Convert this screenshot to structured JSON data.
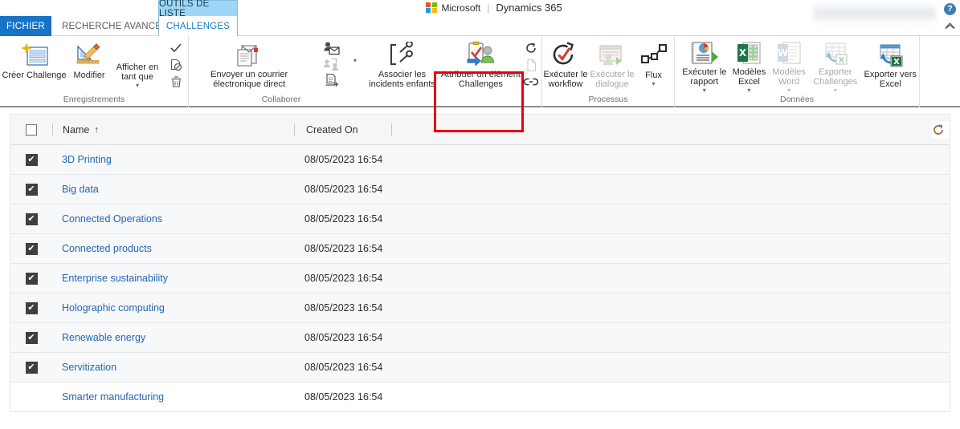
{
  "topbar": {
    "context_tab_group": "OUTILS DE LISTE",
    "tabs": [
      {
        "label": "FICHIER",
        "active": true
      },
      {
        "label": "RECHERCHE AVANCÉE",
        "active": false
      },
      {
        "label": "CHALLENGES",
        "active": false
      }
    ],
    "brand": {
      "microsoft": "Microsoft",
      "separator": "|",
      "product": "Dynamics 365"
    },
    "help_icon_glyph": "?",
    "home_icon_name": "home-icon",
    "user_name_blurred": ""
  },
  "ribbon": {
    "groups": [
      {
        "label": "Enregistrements",
        "buttons": [
          {
            "name": "creer-challenge",
            "label": "Créer Challenge",
            "icon": "new-record-icon",
            "disabled": false,
            "caret": false
          },
          {
            "name": "modifier",
            "label": "Modifier",
            "icon": "edit-pencil-icon",
            "disabled": false,
            "caret": false
          },
          {
            "name": "afficher-en-tant-que",
            "label": "Afficher en tant que",
            "icon": "",
            "disabled": false,
            "caret": true
          }
        ],
        "small_buttons": [
          {
            "name": "activer",
            "icon": "checkmark-icon"
          },
          {
            "name": "desactiver",
            "icon": "deactivate-doc-icon"
          },
          {
            "name": "supprimer",
            "icon": "trash-icon"
          }
        ]
      },
      {
        "label": "Collaborer",
        "buttons": [
          {
            "name": "envoyer-courrier-electronique-direct",
            "label": "Envoyer un courrier électronique direct",
            "icon": "email-document-icon",
            "disabled": false,
            "caret": false
          },
          {
            "name": "associer-les-incidents-enfants",
            "label": "Associer les incidents enfants",
            "icon": "wrench-bracket-icon",
            "disabled": false,
            "caret": false
          }
        ],
        "small_buttons": [
          {
            "name": "ajouter-liste-marketing",
            "icon": "person-mail-icon"
          },
          {
            "name": "connexions",
            "icon": "people-connect-icon"
          },
          {
            "name": "ajouter-note",
            "icon": "add-doc-icon"
          }
        ]
      },
      {
        "label": "",
        "buttons": [
          {
            "name": "attribuer-un-element-challenges",
            "label": "Attribuer un élément Challenges",
            "icon": "assign-record-icon",
            "disabled": false,
            "caret": false,
            "highlighted": true
          }
        ],
        "small_buttons": [
          {
            "name": "actualiser",
            "icon": "refresh-icon"
          },
          {
            "name": "document",
            "icon": "document-icon"
          },
          {
            "name": "lien",
            "icon": "link-icon"
          }
        ]
      },
      {
        "label": "Processus",
        "buttons": [
          {
            "name": "executer-le-workflow",
            "label": "Exécuter le workflow",
            "icon": "workflow-check-icon",
            "disabled": false,
            "caret": false
          },
          {
            "name": "executer-le-dialogue",
            "label": "Exécuter le dialogue",
            "icon": "dialog-run-icon",
            "disabled": true,
            "caret": false
          },
          {
            "name": "flux",
            "label": "Flux",
            "icon": "flow-nodes-icon",
            "disabled": false,
            "caret": true
          }
        ],
        "small_buttons": []
      },
      {
        "label": "Données",
        "buttons": [
          {
            "name": "executer-le-rapport",
            "label": "Exécuter le rapport",
            "icon": "report-chart-icon",
            "disabled": false,
            "caret": true
          },
          {
            "name": "modeles-excel",
            "label": "Modèles Excel",
            "icon": "excel-icon",
            "disabled": false,
            "caret": true
          },
          {
            "name": "modeles-word",
            "label": "Modèles Word",
            "icon": "word-icon",
            "disabled": true,
            "caret": true
          },
          {
            "name": "exporter-challenges",
            "label": "Exporter Challenges",
            "icon": "export-grid-icon",
            "disabled": true,
            "caret": true
          },
          {
            "name": "exporter-vers-excel",
            "label": "Exporter vers Excel",
            "icon": "export-excel-icon",
            "disabled": false,
            "caret": false
          }
        ],
        "small_buttons": []
      }
    ],
    "highlight_color": "#e8000d"
  },
  "grid": {
    "select_all_checked": false,
    "columns": [
      {
        "key": "name",
        "label": "Name",
        "sort": "↑"
      },
      {
        "key": "created_on",
        "label": "Created On",
        "sort": ""
      }
    ],
    "rows": [
      {
        "selected": true,
        "name": "3D Printing",
        "created_on": "08/05/2023 16:54"
      },
      {
        "selected": true,
        "name": "Big data",
        "created_on": "08/05/2023 16:54"
      },
      {
        "selected": true,
        "name": "Connected Operations",
        "created_on": "08/05/2023 16:54"
      },
      {
        "selected": true,
        "name": "Connected products",
        "created_on": "08/05/2023 16:54"
      },
      {
        "selected": true,
        "name": "Enterprise sustainability",
        "created_on": "08/05/2023 16:54"
      },
      {
        "selected": true,
        "name": "Holographic computing",
        "created_on": "08/05/2023 16:54"
      },
      {
        "selected": true,
        "name": "Renewable energy",
        "created_on": "08/05/2023 16:54"
      },
      {
        "selected": true,
        "name": "Servitization",
        "created_on": "08/05/2023 16:54"
      },
      {
        "selected": false,
        "name": "Smarter manufacturing",
        "created_on": "08/05/2023 16:54"
      }
    ],
    "checkbox_glyph": "✔"
  },
  "colors": {
    "accent_blue": "#1773c7",
    "link_blue": "#2266b5",
    "ctx_tab_bg": "#9fd6f5",
    "highlight_red": "#e8000d",
    "row_selected_bg": "#f7f8fa"
  }
}
